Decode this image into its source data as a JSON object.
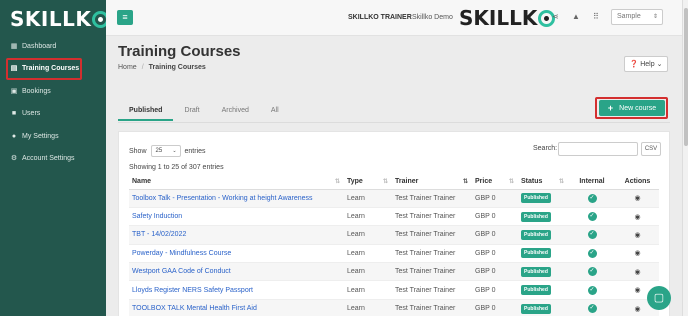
{
  "app": {
    "logo_text": "SKILLK",
    "logo_tail": "O"
  },
  "sidebar": {
    "items": [
      {
        "label": "Dashboard",
        "icon": "grid-icon"
      },
      {
        "label": "Training Courses",
        "icon": "book-icon"
      },
      {
        "label": "Bookings",
        "icon": "bookings-icon"
      },
      {
        "label": "Users",
        "icon": "users-icon"
      },
      {
        "label": "My Settings",
        "icon": "user-settings-icon"
      },
      {
        "label": "Account Settings",
        "icon": "gear-icon"
      }
    ]
  },
  "topbar": {
    "role": "SKILLKO TRAINER",
    "account": "Skillko Demo",
    "select_value": "Sample"
  },
  "page": {
    "title": "Training Courses",
    "breadcrumb_home": "Home",
    "breadcrumb_sep": "/",
    "breadcrumb_current": "Training Courses",
    "help_label": "Help"
  },
  "tabs": [
    "Published",
    "Draft",
    "Archived",
    "All"
  ],
  "new_course_label": "New course",
  "table_controls": {
    "show_label": "Show",
    "show_value": "25",
    "entries_label": "entries",
    "search_label": "Search:",
    "csv_label": "CSV",
    "info": "Showing 1 to 25 of 307 entries"
  },
  "columns": [
    "Name",
    "Type",
    "Trainer",
    "Price",
    "Status",
    "Internal",
    "Actions"
  ],
  "rows": [
    {
      "name": "Toolbox Talk - Presentation - Working at height Awareness",
      "type": "Learn",
      "trainer": "Test Trainer Trainer",
      "price": "GBP 0",
      "status": "Published"
    },
    {
      "name": "Safety Induction",
      "type": "Learn",
      "trainer": "Test Trainer Trainer",
      "price": "GBP 0",
      "status": "Published"
    },
    {
      "name": "TBT - 14/02/2022",
      "type": "Learn",
      "trainer": "Test Trainer Trainer",
      "price": "GBP 0",
      "status": "Published"
    },
    {
      "name": "Powerday - Mindfulness Course",
      "type": "Learn",
      "trainer": "Test Trainer Trainer",
      "price": "GBP 0",
      "status": "Published"
    },
    {
      "name": "Westport GAA Code of Conduct",
      "type": "Learn",
      "trainer": "Test Trainer Trainer",
      "price": "GBP 0",
      "status": "Published"
    },
    {
      "name": "Lloyds Register NERS Safety Passport",
      "type": "Learn",
      "trainer": "Test Trainer Trainer",
      "price": "GBP 0",
      "status": "Published"
    },
    {
      "name": "TOOLBOX TALK Mental Health First Aid",
      "type": "Learn",
      "trainer": "Test Trainer Trainer",
      "price": "GBP 0",
      "status": "Published"
    }
  ],
  "colors": {
    "sidebar_bg": "#23574d",
    "accent": "#2aa488",
    "highlight": "#d32f2f",
    "link": "#2a62c9"
  }
}
